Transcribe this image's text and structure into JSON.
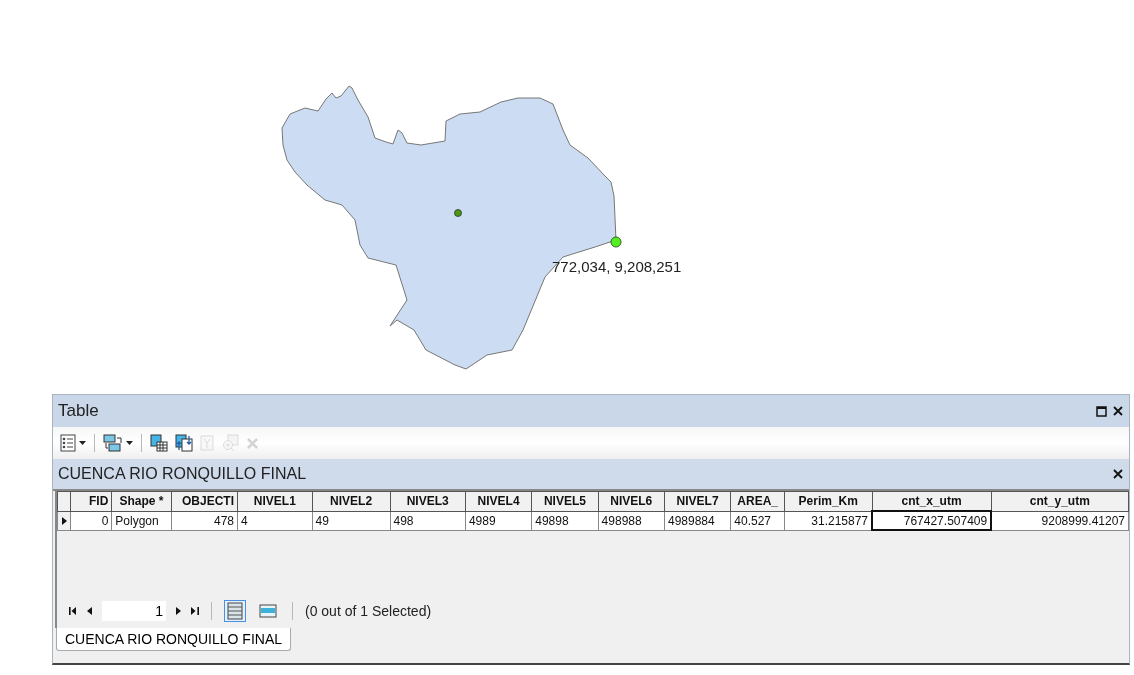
{
  "map": {
    "point_label": "772,034, 9,208,251"
  },
  "table_window": {
    "title": "Table",
    "tools": [
      {
        "kind": "options",
        "disabled": false,
        "dropdown": true
      },
      {
        "kind": "relate",
        "disabled": false,
        "dropdown": true
      },
      {
        "kind": "select-by-attributes",
        "disabled": false,
        "dropdown": false
      },
      {
        "kind": "switch-selection",
        "disabled": false,
        "dropdown": false
      },
      {
        "kind": "clear-selection",
        "disabled": true,
        "dropdown": false
      },
      {
        "kind": "zoom-to-selected",
        "disabled": true,
        "dropdown": false
      },
      {
        "kind": "delete",
        "disabled": true,
        "dropdown": false
      }
    ],
    "layer_title": "CUENCA RIO RONQUILLO FINAL",
    "columns": [
      {
        "label": "FID",
        "kind": "number"
      },
      {
        "label": "Shape *",
        "kind": "text"
      },
      {
        "label": "OBJECTI",
        "kind": "number"
      },
      {
        "label": "NIVEL1",
        "kind": "text"
      },
      {
        "label": "NIVEL2",
        "kind": "text"
      },
      {
        "label": "NIVEL3",
        "kind": "text"
      },
      {
        "label": "NIVEL4",
        "kind": "text"
      },
      {
        "label": "NIVEL5",
        "kind": "text"
      },
      {
        "label": "NIVEL6",
        "kind": "text"
      },
      {
        "label": "NIVEL7",
        "kind": "text"
      },
      {
        "label": "AREA_",
        "kind": "text"
      },
      {
        "label": "Perim_Km",
        "kind": "number"
      },
      {
        "label": "cnt_x_utm",
        "kind": "number"
      },
      {
        "label": "cnt_y_utm",
        "kind": "number"
      }
    ],
    "rows": [
      {
        "current": true,
        "cells": [
          {
            "value": "0",
            "focused": false
          },
          {
            "value": "Polygon",
            "focused": false
          },
          {
            "value": "478",
            "focused": false
          },
          {
            "value": "4",
            "focused": false
          },
          {
            "value": "49",
            "focused": false
          },
          {
            "value": "498",
            "focused": false
          },
          {
            "value": "4989",
            "focused": false
          },
          {
            "value": "49898",
            "focused": false
          },
          {
            "value": "498988",
            "focused": false
          },
          {
            "value": "4989884",
            "focused": false
          },
          {
            "value": "40.527",
            "focused": false
          },
          {
            "value": "31.215877",
            "focused": false
          },
          {
            "value": "767427.507409",
            "focused": true
          },
          {
            "value": "9208999.41207",
            "focused": false
          }
        ]
      }
    ],
    "record_field": {
      "value": "1"
    },
    "views": [
      {
        "kind": "all",
        "selected": true
      },
      {
        "kind": "selected",
        "selected": false
      }
    ],
    "selection_status": "(0 out of 1 Selected)",
    "tabs": [
      {
        "label": "CUENCA RIO RONQUILLO FINAL",
        "selected": true
      }
    ]
  }
}
